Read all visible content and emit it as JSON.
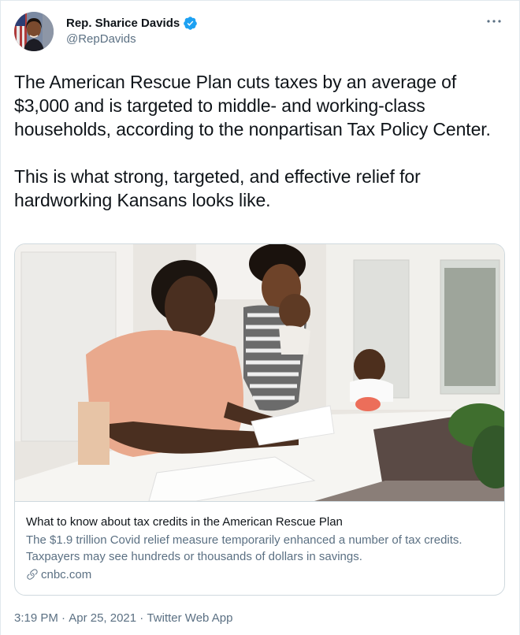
{
  "author": {
    "display_name": "Rep. Sharice Davids",
    "handle": "@RepDavids",
    "avatar_icon": "avatar-photo",
    "verified_icon": "verified-badge-icon",
    "verified_color": "#1da1f2"
  },
  "more_icon": "more-options-icon",
  "tweet": {
    "text": "The American Rescue Plan cuts taxes by an average of $3,000 and is targeted to middle- and working-class households, according to the nonpartisan Tax Policy Center.\n\nThis is what strong, targeted, and effective relief for hardworking Kansans looks like."
  },
  "card": {
    "image_icon": "article-photo-family-doing-taxes",
    "title": "What to know about tax credits in the American Rescue Plan",
    "description": "The $1.9 trillion Covid relief measure temporarily enhanced a number of tax credits. Taxpayers may see hundreds or thousands of dollars in savings.",
    "domain": "cnbc.com",
    "link_icon": "link-icon"
  },
  "meta": {
    "time": "3:19 PM",
    "separator": " · ",
    "date": "Apr 25, 2021",
    "source": "Twitter Web App"
  },
  "colors": {
    "text": "#0f1419",
    "secondary": "#5b7083",
    "border": "#cfd9de"
  }
}
